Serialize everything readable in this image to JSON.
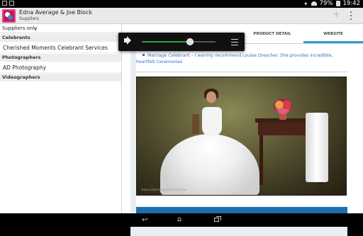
{
  "status_bar": {
    "battery_percent": "79%",
    "time": "19:42"
  },
  "app": {
    "title": "Edna Average & Joe Block",
    "subtitle": "Suppliers"
  },
  "filter": {
    "selected": "Suppliers only"
  },
  "categories": [
    {
      "label": "Celebrants"
    },
    {
      "label": "Photographers"
    },
    {
      "label": "Videographers"
    }
  ],
  "items": [
    {
      "label": "Cherished Moments Celebrant Services"
    },
    {
      "label": "AD Photography"
    }
  ],
  "tabs": [
    {
      "label": "PRODUCT DETAIL"
    },
    {
      "label": "WEBSITE",
      "active": true
    }
  ],
  "website": {
    "quote": "Marriage Celebrant – I warmly recommend Louise Drescher. She provides incredible, heartfelt Ceremonies",
    "watermark": "www.adphotography.com.au"
  },
  "volume": {
    "level": 0.65
  },
  "colors": {
    "accent": "#2a9fd6",
    "link": "#3a6dc4",
    "volume_fill": "#2ba53a"
  }
}
